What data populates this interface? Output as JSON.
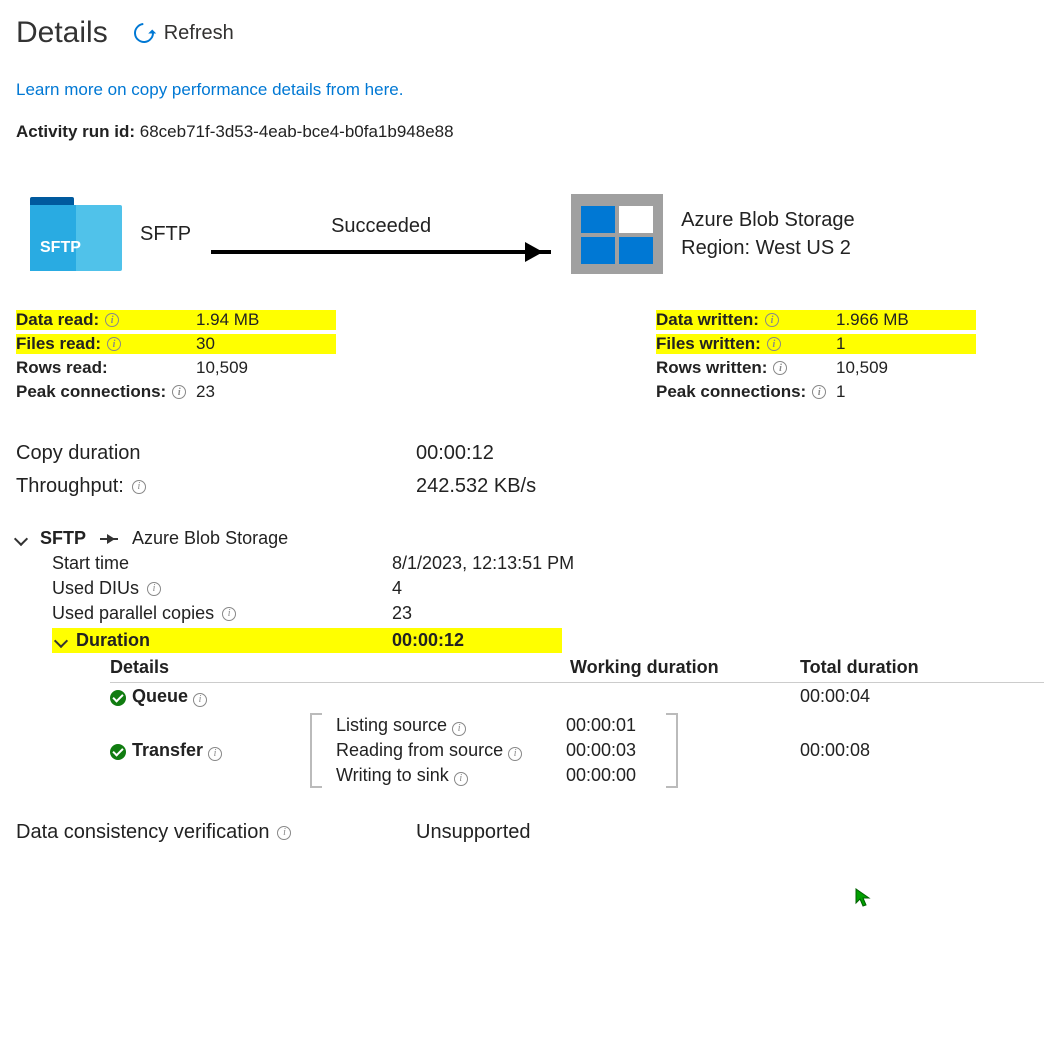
{
  "header": {
    "title": "Details",
    "refresh": "Refresh",
    "learn_more": "Learn more on copy performance details from here.",
    "run_id_label": "Activity run id:",
    "run_id": "68ceb71f-3d53-4eab-bce4-b0fa1b948e88"
  },
  "diagram": {
    "source_label": "SFTP",
    "source_icon_text": "SFTP",
    "status": "Succeeded",
    "sink_line1": "Azure Blob Storage",
    "sink_region_label": "Region:",
    "sink_region": "West US 2"
  },
  "source_stats": {
    "data_read_label": "Data read:",
    "data_read": "1.94 MB",
    "files_read_label": "Files read:",
    "files_read": "30",
    "rows_read_label": "Rows read:",
    "rows_read": "10,509",
    "peak_conn_label": "Peak connections:",
    "peak_conn": "23"
  },
  "sink_stats": {
    "data_written_label": "Data written:",
    "data_written": "1.966 MB",
    "files_written_label": "Files written:",
    "files_written": "1",
    "rows_written_label": "Rows written:",
    "rows_written": "10,509",
    "peak_conn_label": "Peak connections:",
    "peak_conn": "1"
  },
  "perf": {
    "copy_duration_label": "Copy duration",
    "copy_duration": "00:00:12",
    "throughput_label": "Throughput:",
    "throughput": "242.532 KB/s"
  },
  "crumb": {
    "source": "SFTP",
    "sink": "Azure Blob Storage"
  },
  "details": {
    "start_time_label": "Start time",
    "start_time": "8/1/2023, 12:13:51 PM",
    "used_dius_label": "Used DIUs",
    "used_dius": "4",
    "used_parallel_label": "Used parallel copies",
    "used_parallel": "23",
    "duration_label": "Duration",
    "duration": "00:00:12"
  },
  "dur_table": {
    "headers": {
      "details": "Details",
      "working": "Working duration",
      "total": "Total duration"
    },
    "queue": {
      "label": "Queue",
      "total": "00:00:04"
    },
    "transfer": {
      "label": "Transfer",
      "total": "00:00:08",
      "subs": {
        "listing_label": "Listing source",
        "listing_val": "00:00:01",
        "reading_label": "Reading from source",
        "reading_val": "00:00:03",
        "writing_label": "Writing to sink",
        "writing_val": "00:00:00"
      }
    }
  },
  "bottom": {
    "dcv_label": "Data consistency verification",
    "dcv_value": "Unsupported"
  }
}
